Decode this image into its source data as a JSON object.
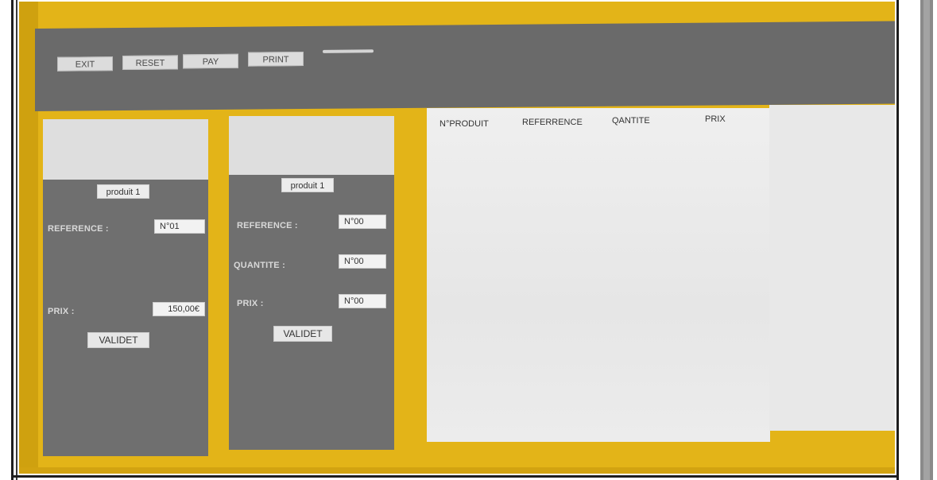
{
  "toolbar": {
    "exit_label": "EXIT",
    "reset_label": "RESET",
    "pay_label": "PAY",
    "print_label": "PRINT"
  },
  "product_card_1": {
    "title": "produit 1",
    "reference_label": "REFERENCE :",
    "reference_value": "N°01",
    "prix_label": "PRIX :",
    "prix_value": "150,00€",
    "validet_label": "VALIDET"
  },
  "product_card_2": {
    "title": "produit 1",
    "reference_label": "REFERENCE :",
    "reference_value": "N°00",
    "quantite_label": "QUANTITE :",
    "quantite_value": "N°00",
    "prix_label": "PRIX :",
    "prix_value": "N°00",
    "validet_label": "VALIDET"
  },
  "table": {
    "columns": [
      "N°PRODUIT",
      "REFERRENCE",
      "QANTITE",
      "PRIX"
    ],
    "rows": []
  },
  "colors": {
    "accent_yellow": "#e3b418",
    "panel_gray": "#6f6f6f",
    "toolbar_gray": "#6a6a6a"
  }
}
